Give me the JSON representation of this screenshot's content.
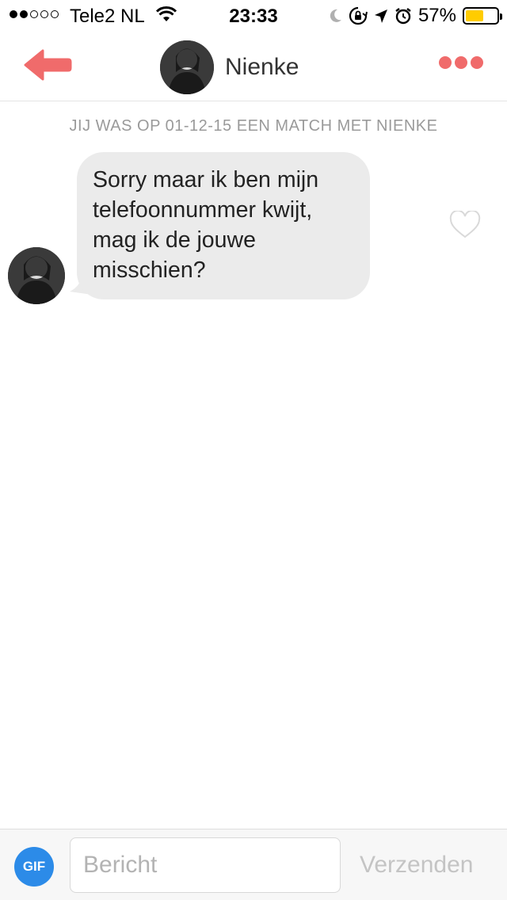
{
  "status_bar": {
    "carrier": "Tele2 NL",
    "time": "23:33",
    "battery_percent": "57%",
    "battery_level": 0.57,
    "signal_bars_filled": 2,
    "signal_bars_total": 5,
    "icons": [
      "signal-dots-icon",
      "wifi-icon",
      "moon-icon",
      "rotation-lock-icon",
      "location-arrow-icon",
      "alarm-icon",
      "battery-icon"
    ]
  },
  "header": {
    "contact_name": "Nienke",
    "back_icon": "back-arrow-icon",
    "more_icon": "more-dots-icon",
    "accent_color": "#f06b6b"
  },
  "chat": {
    "match_info": "JIJ WAS OP 01-12-15 EEN MATCH MET NIENKE",
    "messages": [
      {
        "text": "Sorry maar ik ben mijn telefoonnummer kwijt, mag ik de jouwe misschien?",
        "liked": false
      }
    ]
  },
  "composer": {
    "gif_label": "GIF",
    "gif_color": "#2c8be8",
    "input_placeholder": "Bericht",
    "input_value": "",
    "send_label": "Verzenden"
  }
}
